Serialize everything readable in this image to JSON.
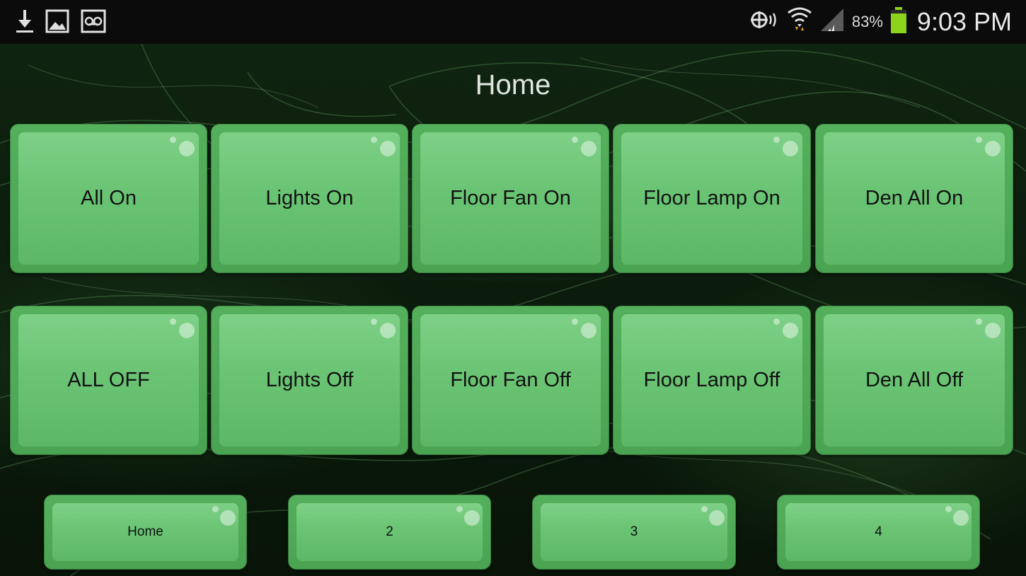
{
  "status_bar": {
    "left_icons": [
      "download-icon",
      "image-icon",
      "voicemail-icon"
    ],
    "right_icons": [
      "nfc-icon",
      "wifi-icon",
      "signal-icon",
      "battery-icon"
    ],
    "battery_percent": "83%",
    "time": "9:03 PM"
  },
  "page": {
    "title": "Home"
  },
  "buttons": {
    "all_on": "All On",
    "lights_on": "Lights On",
    "floor_fan_on": "Floor Fan On",
    "floor_lamp_on": "Floor Lamp On",
    "den_all_on": "Den All On",
    "all_off": "ALL OFF",
    "lights_off": "Lights Off",
    "floor_fan_off": "Floor Fan Off",
    "floor_lamp_off": "Floor Lamp Off",
    "den_all_off": "Den All Off"
  },
  "nav": {
    "page1": "Home",
    "page2": "2",
    "page3": "3",
    "page4": "4"
  },
  "colors": {
    "tile_face": "#6ac474",
    "tile_border": "#4aa352",
    "battery": "#8cd31b",
    "status_bar": "#0b0b0b"
  }
}
